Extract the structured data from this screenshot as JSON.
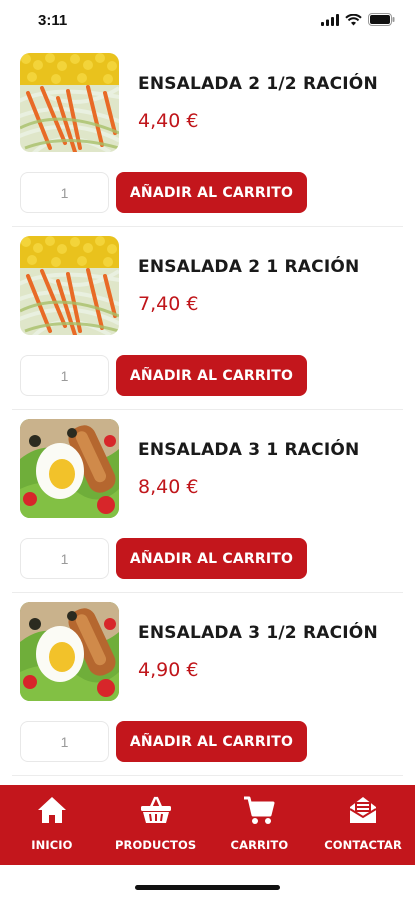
{
  "status_bar": {
    "time": "3:11"
  },
  "products": [
    {
      "name": "ENSALADA 2 1/2 RACIÓN",
      "price": "4,40 €",
      "image": "ensalada-2",
      "qty": "1",
      "add_label": "AÑADIR AL CARRITO"
    },
    {
      "name": "ENSALADA 2 1 RACIÓN",
      "price": "7,40 €",
      "image": "ensalada-2",
      "qty": "1",
      "add_label": "AÑADIR AL CARRITO"
    },
    {
      "name": "ENSALADA 3 1 RACIÓN",
      "price": "8,40 €",
      "image": "ensalada-3",
      "qty": "1",
      "add_label": "AÑADIR AL CARRITO"
    },
    {
      "name": "ENSALADA 3 1/2 RACIÓN",
      "price": "4,90 €",
      "image": "ensalada-3",
      "qty": "1",
      "add_label": "AÑADIR AL CARRITO"
    }
  ],
  "nav": {
    "items": [
      {
        "label": "INICIO",
        "icon": "home-icon"
      },
      {
        "label": "PRODUCTOS",
        "icon": "basket-icon"
      },
      {
        "label": "CARRITO",
        "icon": "cart-icon"
      },
      {
        "label": "CONTACTAR",
        "icon": "mail-icon"
      }
    ]
  },
  "colors": {
    "accent": "#c3161c",
    "price": "#c0161b"
  }
}
